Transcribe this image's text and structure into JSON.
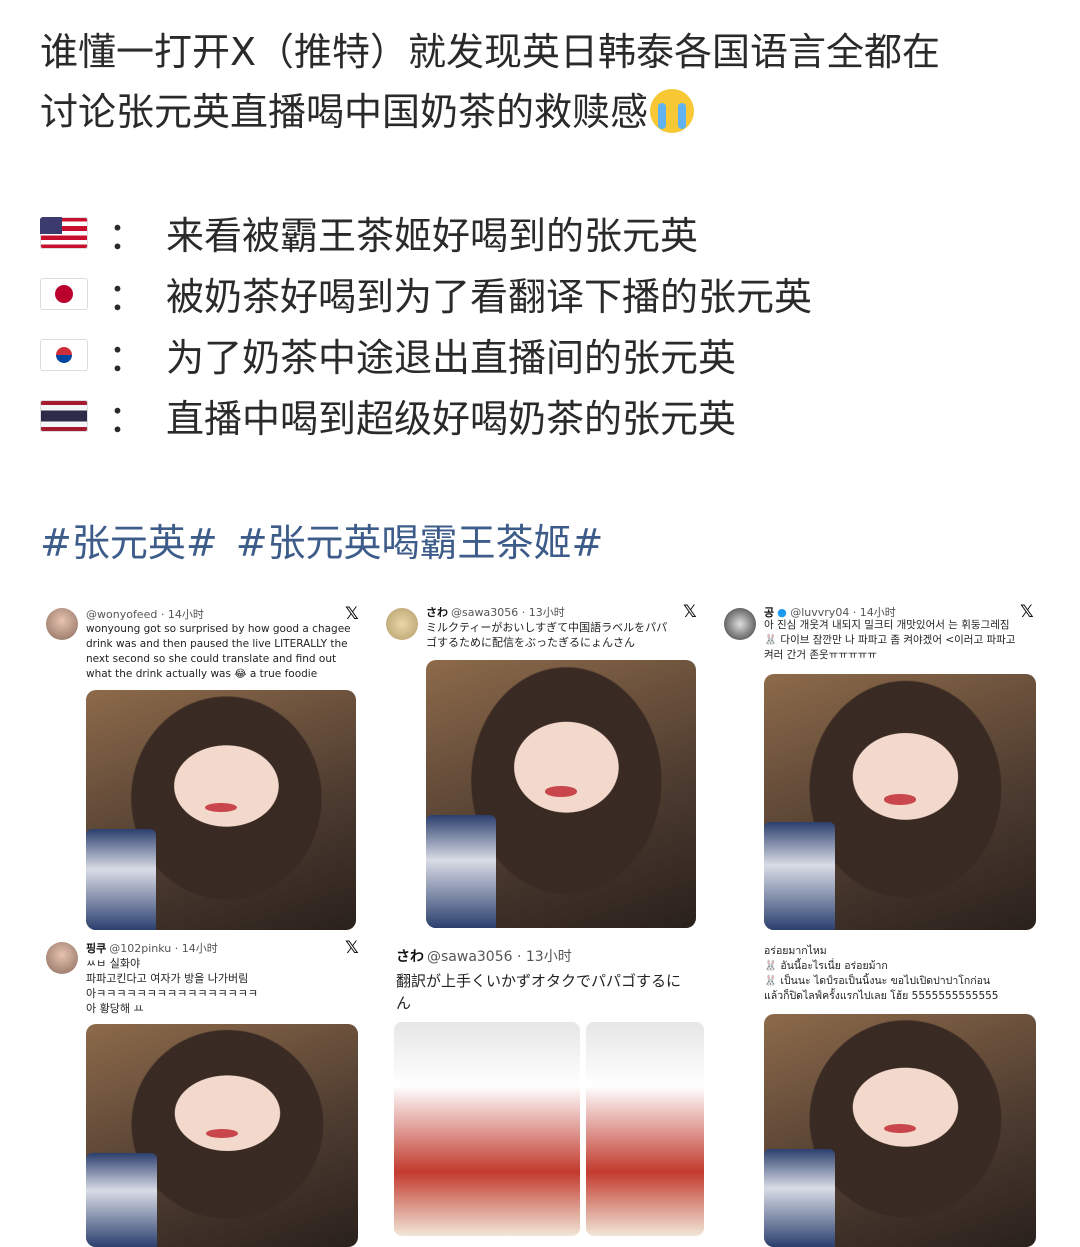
{
  "intro": {
    "line1": "谁懂一打开X（推特）就发现英日韩泰各国语言全都在",
    "line2": "讨论张元英直播喝中国奶茶的救赎感"
  },
  "flags": [
    {
      "icon": "us-flag-icon",
      "text": "来看被霸王茶姬好喝到的张元英"
    },
    {
      "icon": "jp-flag-icon",
      "text": "被奶茶好喝到为了看翻译下播的张元英"
    },
    {
      "icon": "kr-flag-icon",
      "text": "为了奶茶中途退出直播间的张元英"
    },
    {
      "icon": "th-flag-icon",
      "text": "直播中喝到超级好喝奶茶的张元英"
    }
  ],
  "hashtags": [
    "#张元英#",
    "#张元英喝霸王茶姬#"
  ],
  "tweets": [
    {
      "name": "",
      "handle": "@wonyofeed · 14小时",
      "text": "wonyoung got so surprised by how good a chagee\ndrink was and then paused the live LITERALLY the\nnext second so she could translate and find out\nwhat the drink actually was 😂 a true foodie"
    },
    {
      "name": "さわ",
      "handle": "@sawa3056 · 13小时",
      "text": "ミルクティーがおいしすぎて中国語ラベルをパパ\nゴするために配信をぶったぎるにょんさん"
    },
    {
      "name": "공",
      "handle": "@luvvry04 · 14小时",
      "text": "아 진심 개웃겨 내되지 밀크티 개맛있어서 는 휘둥그레짐\n🐰 다이브 잠깐만 나 파파고 좀 켜야겠어 <이러고 파파고\n켜러 간거 존웃ㅠㅠㅠㅠㅠ"
    },
    {
      "name": "핑쿠",
      "handle": "@102pinku · 14小时",
      "text": "ㅆㅂ 실화야\n파파고킨다고 여자가 방을 나가버림\n아ㅋㅋㅋㅋㅋㅋㅋㅋㅋㅋㅋㅋㅋㅋㅋㅋ\n아 황당해 ㅛ"
    },
    {
      "name": "さわ",
      "handle": "@sawa3056 · 13小时",
      "text": "翻訳が上手くいかずオタクでパパゴするに\nん"
    },
    {
      "name": "",
      "handle": "",
      "text": "อร่อยมากไหม\n🐰 อันนี้อะไรเนี่ย อร่อยม้าก\n🐰 เป็นนะ ไดป์รอเป็นนิ้งนะ ขอไปเปิดปาปาโกก่อน\nแล้วก็ปิดไลฟ์ครั้งแรกไปเลย โฮ้ย 5555555555555"
    }
  ]
}
